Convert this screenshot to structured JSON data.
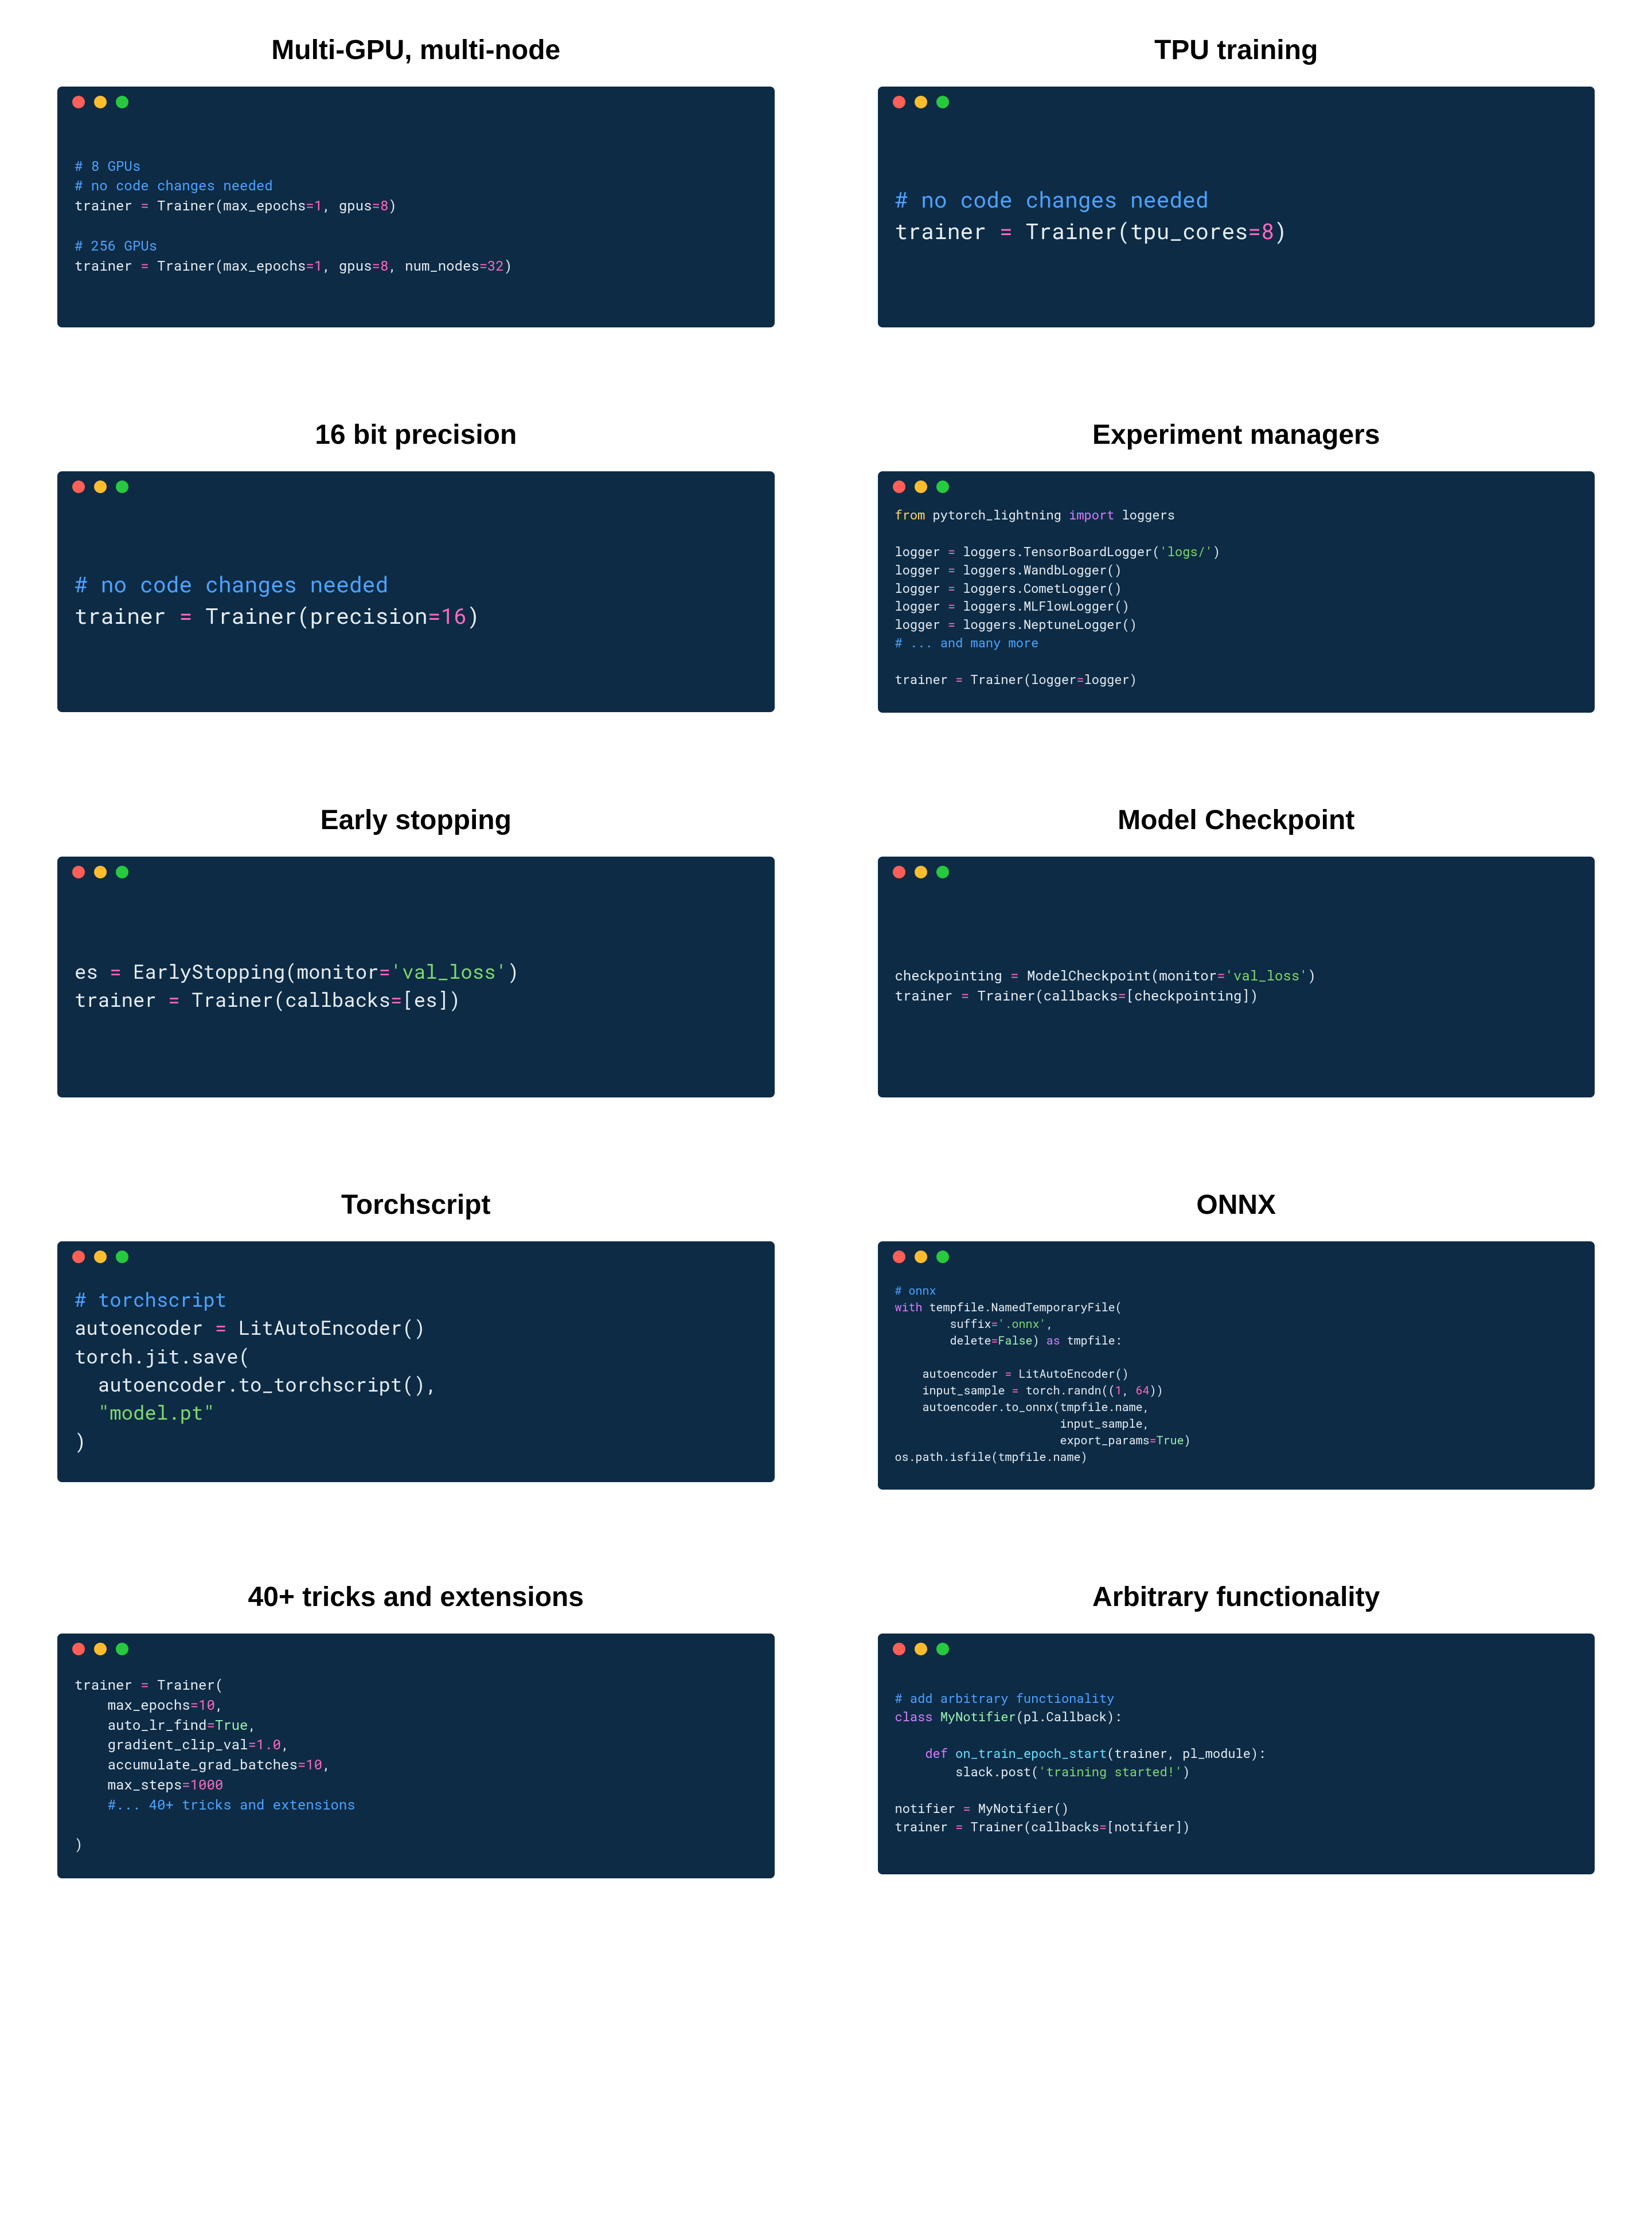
{
  "cards": [
    {
      "id": "multi-gpu",
      "title": "Multi-GPU, multi-node",
      "size": "fs-sm",
      "align": "center",
      "code_html": "<span class='c-comment'># 8 GPUs</span>\n<span class='c-comment'># no code changes needed</span>\ntrainer <span class='c-eq'>=</span> Trainer(max_epochs<span class='c-eq'>=</span><span class='c-num'>1</span>, gpus<span class='c-eq'>=</span><span class='c-num'>8</span>)\n\n<span class='c-comment'># 256 GPUs</span>\ntrainer <span class='c-eq'>=</span> Trainer(max_epochs<span class='c-eq'>=</span><span class='c-num'>1</span>, gpus<span class='c-eq'>=</span><span class='c-num'>8</span>, num_nodes<span class='c-eq'>=</span><span class='c-num'>32</span>)"
    },
    {
      "id": "tpu",
      "title": "TPU training",
      "size": "fs-xl",
      "align": "center",
      "code_html": "<span class='c-comment'># no code changes needed</span>\ntrainer <span class='c-eq'>=</span> Trainer(tpu_cores<span class='c-eq'>=</span><span class='c-num'>8</span>)"
    },
    {
      "id": "sixteen-bit",
      "title": "16 bit precision",
      "size": "fs-xl",
      "align": "center",
      "code_html": "<span class='c-comment'># no code changes needed</span>\ntrainer <span class='c-eq'>=</span> Trainer(precision<span class='c-eq'>=</span><span class='c-num'>16</span>)"
    },
    {
      "id": "exp-managers",
      "title": "Experiment managers",
      "size": "fs-xs",
      "align": "top",
      "code_html": "<span class='c-import'>from</span> pytorch_lightning <span class='c-kw'>import</span> loggers\n\nlogger <span class='c-eq'>=</span> loggers.TensorBoardLogger(<span class='c-str'>'logs/'</span>)\nlogger <span class='c-eq'>=</span> loggers.WandbLogger()\nlogger <span class='c-eq'>=</span> loggers.CometLogger()\nlogger <span class='c-eq'>=</span> loggers.MLFlowLogger()\nlogger <span class='c-eq'>=</span> loggers.NeptuneLogger()\n<span class='c-comment'># ... and many more</span>\n\ntrainer <span class='c-eq'>=</span> Trainer(logger<span class='c-eq'>=</span>logger)"
    },
    {
      "id": "early-stopping",
      "title": "Early stopping",
      "size": "fs-lg",
      "align": "center",
      "code_html": "es <span class='c-eq'>=</span> EarlyStopping(monitor<span class='c-eq'>=</span><span class='c-str'>'val_loss'</span>)\ntrainer <span class='c-eq'>=</span> Trainer(callbacks<span class='c-eq'>=</span>[es])"
    },
    {
      "id": "model-checkpoint",
      "title": "Model Checkpoint",
      "size": "fs-sm",
      "align": "center",
      "code_html": "checkpointing <span class='c-eq'>=</span> ModelCheckpoint(monitor<span class='c-eq'>=</span><span class='c-str'>'val_loss'</span>)\ntrainer <span class='c-eq'>=</span> Trainer(callbacks<span class='c-eq'>=</span>[checkpointing])"
    },
    {
      "id": "torchscript",
      "title": "Torchscript",
      "size": "fs-lg",
      "align": "center",
      "code_html": "<span class='c-comment'># torchscript</span>\nautoencoder <span class='c-eq'>=</span> LitAutoEncoder()\ntorch.jit.save(\n  autoencoder.to_torchscript(),\n  <span class='c-str'>\"model.pt\"</span>\n)"
    },
    {
      "id": "onnx",
      "title": "ONNX",
      "size": "fs-xxs",
      "align": "center",
      "code_html": "<span class='c-comment'># onnx</span>\n<span class='c-kw'>with</span> tempfile.NamedTemporaryFile(\n        suffix<span class='c-eq'>=</span><span class='c-str'>'.onnx'</span>,\n        delete<span class='c-eq'>=</span><span class='c-bool'>False</span>) <span class='c-kw'>as</span> tmpfile:\n\n    autoencoder <span class='c-eq'>=</span> LitAutoEncoder()\n    input_sample <span class='c-eq'>=</span> torch.randn((<span class='c-num'>1</span>, <span class='c-num'>64</span>))\n    autoencoder.to_onnx(tmpfile.name,\n                        input_sample,\n                        export_params<span class='c-eq'>=</span><span class='c-bool'>True</span>)\nos.path.isfile(tmpfile.name)"
    },
    {
      "id": "tricks",
      "title": "40+ tricks and extensions",
      "size": "fs-sm",
      "align": "center",
      "code_html": "trainer <span class='c-eq'>=</span> Trainer(\n    max_epochs<span class='c-eq'>=</span><span class='c-num'>10</span>,\n    auto_lr_find<span class='c-eq'>=</span><span class='c-bool'>True</span>,\n    gradient_clip_val<span class='c-eq'>=</span><span class='c-num'>1.0</span>,\n    accumulate_grad_batches<span class='c-eq'>=</span><span class='c-num'>10</span>,\n    max_steps<span class='c-eq'>=</span><span class='c-num'>1000</span>\n    <span class='c-comment'>#... 40+ tricks and extensions</span>\n\n)"
    },
    {
      "id": "arbitrary",
      "title": "Arbitrary functionality",
      "size": "fs-xs",
      "align": "center",
      "code_html": "<span class='c-comment'># add arbitrary functionality</span>\n<span class='c-kw'>class</span> <span class='c-cls'>MyNotifier</span>(pl.Callback):\n\n    <span class='c-kw'>def</span> <span class='c-def'>on_train_epoch_start</span>(trainer, pl_module):\n        slack.post(<span class='c-str'>'training started!'</span>)\n\nnotifier <span class='c-eq'>=</span> MyNotifier()\ntrainer <span class='c-eq'>=</span> Trainer(callbacks<span class='c-eq'>=</span>[notifier])"
    }
  ]
}
